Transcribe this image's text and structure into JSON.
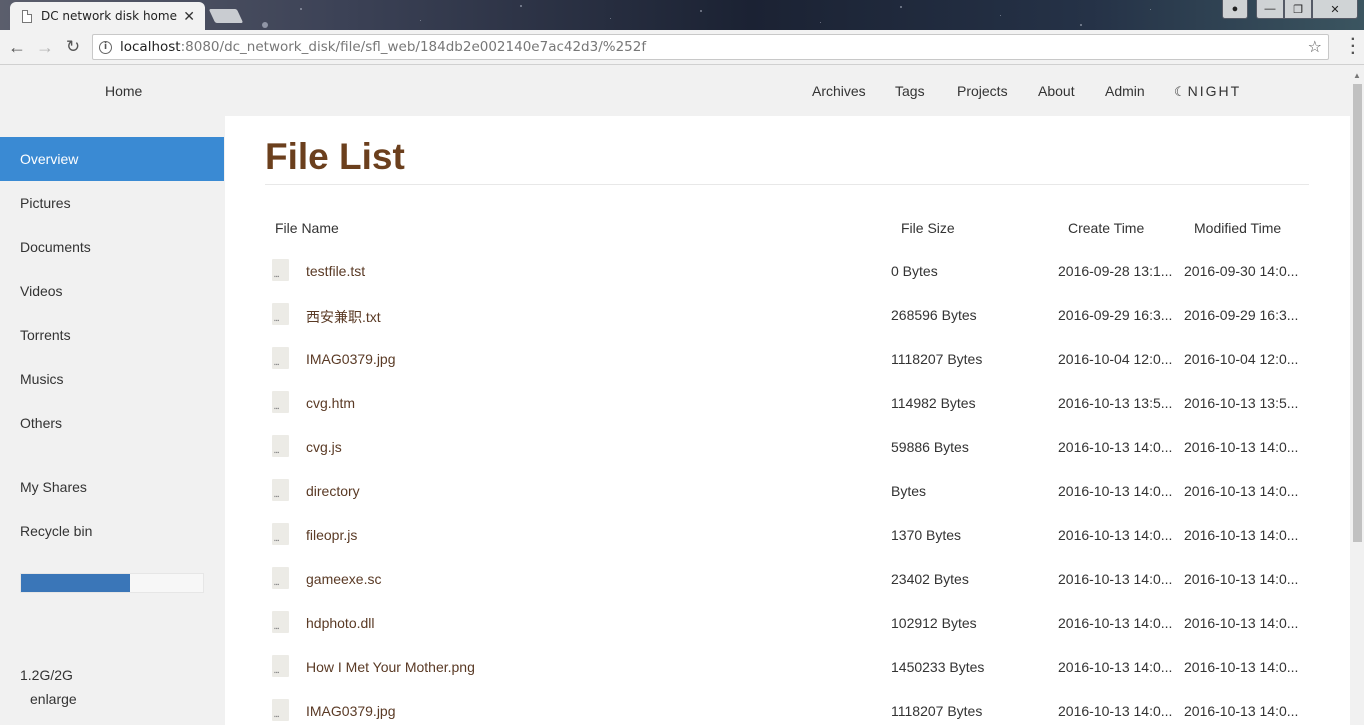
{
  "browser": {
    "tab_title": "DC network disk home",
    "url_host": "localhost",
    "url_path": ":8080/dc_network_disk/file/sfl_web/184db2e002140e7ac42d3/%252f"
  },
  "topnav": {
    "home": "Home",
    "archives": "Archives",
    "tags": "Tags",
    "projects": "Projects",
    "about": "About",
    "admin": "Admin",
    "night": "NIGHT"
  },
  "sidebar": {
    "items": [
      "Overview",
      "Pictures",
      "Documents",
      "Videos",
      "Torrents",
      "Musics",
      "Others"
    ],
    "shares": "My Shares",
    "recycle": "Recycle bin",
    "usage_fraction": 0.6,
    "usage_text": "1.2G/2G",
    "enlarge": "enlarge",
    "active_color": "#3a8ad3"
  },
  "main": {
    "title": "File List",
    "title_color": "#6b3f1d",
    "columns": [
      "File Name",
      "File Size",
      "Create Time",
      "Modified Time"
    ],
    "rows": [
      {
        "name": "testfile.tst",
        "size": "0 Bytes",
        "created": "2016-09-28 13:1...",
        "modified": "2016-09-30 14:0..."
      },
      {
        "name": "西安兼职.txt",
        "size": "268596 Bytes",
        "created": "2016-09-29 16:3...",
        "modified": "2016-09-29 16:3..."
      },
      {
        "name": "IMAG0379.jpg",
        "size": "1118207 Bytes",
        "created": "2016-10-04 12:0...",
        "modified": "2016-10-04 12:0..."
      },
      {
        "name": "cvg.htm",
        "size": "114982 Bytes",
        "created": "2016-10-13 13:5...",
        "modified": "2016-10-13 13:5..."
      },
      {
        "name": "cvg.js",
        "size": "59886 Bytes",
        "created": "2016-10-13 14:0...",
        "modified": "2016-10-13 14:0..."
      },
      {
        "name": "directory",
        "size": "Bytes",
        "created": "2016-10-13 14:0...",
        "modified": "2016-10-13 14:0..."
      },
      {
        "name": "fileopr.js",
        "size": "1370 Bytes",
        "created": "2016-10-13 14:0...",
        "modified": "2016-10-13 14:0..."
      },
      {
        "name": "gameexe.sc",
        "size": "23402 Bytes",
        "created": "2016-10-13 14:0...",
        "modified": "2016-10-13 14:0..."
      },
      {
        "name": "hdphoto.dll",
        "size": "102912 Bytes",
        "created": "2016-10-13 14:0...",
        "modified": "2016-10-13 14:0..."
      },
      {
        "name": "How I Met Your Mother.png",
        "size": "1450233 Bytes",
        "created": "2016-10-13 14:0...",
        "modified": "2016-10-13 14:0..."
      },
      {
        "name": "IMAG0379.jpg",
        "size": "1118207 Bytes",
        "created": "2016-10-13 14:0...",
        "modified": "2016-10-13 14:0..."
      }
    ]
  }
}
